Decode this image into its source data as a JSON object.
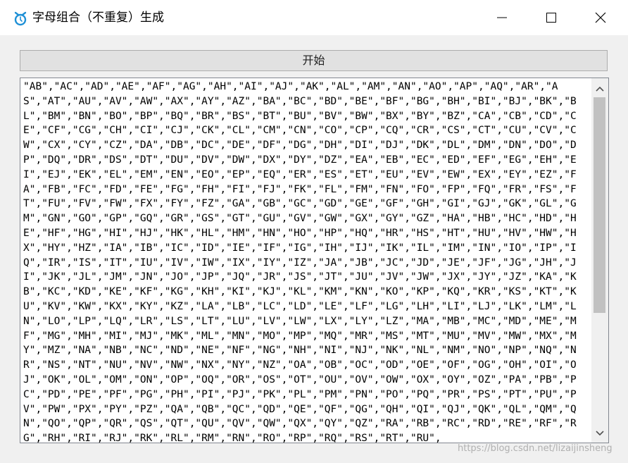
{
  "window": {
    "title": "字母组合（不重复）生成",
    "controls": {
      "minimize": "minimize",
      "maximize": "maximize",
      "close": "close"
    }
  },
  "toolbar": {
    "start_label": "开始"
  },
  "output": {
    "text": "\"AB\",\"AC\",\"AD\",\"AE\",\"AF\",\"AG\",\"AH\",\"AI\",\"AJ\",\"AK\",\"AL\",\"AM\",\"AN\",\"AO\",\"AP\",\"AQ\",\"AR\",\"AS\",\"AT\",\"AU\",\"AV\",\"AW\",\"AX\",\"AY\",\"AZ\",\"BA\",\"BC\",\"BD\",\"BE\",\"BF\",\"BG\",\"BH\",\"BI\",\"BJ\",\"BK\",\"BL\",\"BM\",\"BN\",\"BO\",\"BP\",\"BQ\",\"BR\",\"BS\",\"BT\",\"BU\",\"BV\",\"BW\",\"BX\",\"BY\",\"BZ\",\"CA\",\"CB\",\"CD\",\"CE\",\"CF\",\"CG\",\"CH\",\"CI\",\"CJ\",\"CK\",\"CL\",\"CM\",\"CN\",\"CO\",\"CP\",\"CQ\",\"CR\",\"CS\",\"CT\",\"CU\",\"CV\",\"CW\",\"CX\",\"CY\",\"CZ\",\"DA\",\"DB\",\"DC\",\"DE\",\"DF\",\"DG\",\"DH\",\"DI\",\"DJ\",\"DK\",\"DL\",\"DM\",\"DN\",\"DO\",\"DP\",\"DQ\",\"DR\",\"DS\",\"DT\",\"DU\",\"DV\",\"DW\",\"DX\",\"DY\",\"DZ\",\"EA\",\"EB\",\"EC\",\"ED\",\"EF\",\"EG\",\"EH\",\"EI\",\"EJ\",\"EK\",\"EL\",\"EM\",\"EN\",\"EO\",\"EP\",\"EQ\",\"ER\",\"ES\",\"ET\",\"EU\",\"EV\",\"EW\",\"EX\",\"EY\",\"EZ\",\"FA\",\"FB\",\"FC\",\"FD\",\"FE\",\"FG\",\"FH\",\"FI\",\"FJ\",\"FK\",\"FL\",\"FM\",\"FN\",\"FO\",\"FP\",\"FQ\",\"FR\",\"FS\",\"FT\",\"FU\",\"FV\",\"FW\",\"FX\",\"FY\",\"FZ\",\"GA\",\"GB\",\"GC\",\"GD\",\"GE\",\"GF\",\"GH\",\"GI\",\"GJ\",\"GK\",\"GL\",\"GM\",\"GN\",\"GO\",\"GP\",\"GQ\",\"GR\",\"GS\",\"GT\",\"GU\",\"GV\",\"GW\",\"GX\",\"GY\",\"GZ\",\"HA\",\"HB\",\"HC\",\"HD\",\"HE\",\"HF\",\"HG\",\"HI\",\"HJ\",\"HK\",\"HL\",\"HM\",\"HN\",\"HO\",\"HP\",\"HQ\",\"HR\",\"HS\",\"HT\",\"HU\",\"HV\",\"HW\",\"HX\",\"HY\",\"HZ\",\"IA\",\"IB\",\"IC\",\"ID\",\"IE\",\"IF\",\"IG\",\"IH\",\"IJ\",\"IK\",\"IL\",\"IM\",\"IN\",\"IO\",\"IP\",\"IQ\",\"IR\",\"IS\",\"IT\",\"IU\",\"IV\",\"IW\",\"IX\",\"IY\",\"IZ\",\"JA\",\"JB\",\"JC\",\"JD\",\"JE\",\"JF\",\"JG\",\"JH\",\"JI\",\"JK\",\"JL\",\"JM\",\"JN\",\"JO\",\"JP\",\"JQ\",\"JR\",\"JS\",\"JT\",\"JU\",\"JV\",\"JW\",\"JX\",\"JY\",\"JZ\",\"KA\",\"KB\",\"KC\",\"KD\",\"KE\",\"KF\",\"KG\",\"KH\",\"KI\",\"KJ\",\"KL\",\"KM\",\"KN\",\"KO\",\"KP\",\"KQ\",\"KR\",\"KS\",\"KT\",\"KU\",\"KV\",\"KW\",\"KX\",\"KY\",\"KZ\",\"LA\",\"LB\",\"LC\",\"LD\",\"LE\",\"LF\",\"LG\",\"LH\",\"LI\",\"LJ\",\"LK\",\"LM\",\"LN\",\"LO\",\"LP\",\"LQ\",\"LR\",\"LS\",\"LT\",\"LU\",\"LV\",\"LW\",\"LX\",\"LY\",\"LZ\",\"MA\",\"MB\",\"MC\",\"MD\",\"ME\",\"MF\",\"MG\",\"MH\",\"MI\",\"MJ\",\"MK\",\"ML\",\"MN\",\"MO\",\"MP\",\"MQ\",\"MR\",\"MS\",\"MT\",\"MU\",\"MV\",\"MW\",\"MX\",\"MY\",\"MZ\",\"NA\",\"NB\",\"NC\",\"ND\",\"NE\",\"NF\",\"NG\",\"NH\",\"NI\",\"NJ\",\"NK\",\"NL\",\"NM\",\"NO\",\"NP\",\"NQ\",\"NR\",\"NS\",\"NT\",\"NU\",\"NV\",\"NW\",\"NX\",\"NY\",\"NZ\",\"OA\",\"OB\",\"OC\",\"OD\",\"OE\",\"OF\",\"OG\",\"OH\",\"OI\",\"OJ\",\"OK\",\"OL\",\"OM\",\"ON\",\"OP\",\"OQ\",\"OR\",\"OS\",\"OT\",\"OU\",\"OV\",\"OW\",\"OX\",\"OY\",\"OZ\",\"PA\",\"PB\",\"PC\",\"PD\",\"PE\",\"PF\",\"PG\",\"PH\",\"PI\",\"PJ\",\"PK\",\"PL\",\"PM\",\"PN\",\"PO\",\"PQ\",\"PR\",\"PS\",\"PT\",\"PU\",\"PV\",\"PW\",\"PX\",\"PY\",\"PZ\",\"QA\",\"QB\",\"QC\",\"QD\",\"QE\",\"QF\",\"QG\",\"QH\",\"QI\",\"QJ\",\"QK\",\"QL\",\"QM\",\"QN\",\"QO\",\"QP\",\"QR\",\"QS\",\"QT\",\"QU\",\"QV\",\"QW\",\"QX\",\"QY\",\"QZ\",\"RA\",\"RB\",\"RC\",\"RD\",\"RE\",\"RF\",\"RG\",\"RH\",\"RI\",\"RJ\",\"RK\",\"RL\",\"RM\",\"RN\",\"RO\",\"RP\",\"RQ\",\"RS\",\"RT\",\"RU\","
  },
  "scrollbar": {
    "position_fraction": 0.0,
    "visible_fraction": 0.6
  },
  "watermark": "https://blog.csdn.net/lizaijinsheng",
  "colors": {
    "window_bg": "#f0f0f0",
    "titlebar_bg": "#ffffff",
    "icon_accent": "#1e90d6"
  },
  "icons": {
    "app": "alarm-clock-icon"
  }
}
